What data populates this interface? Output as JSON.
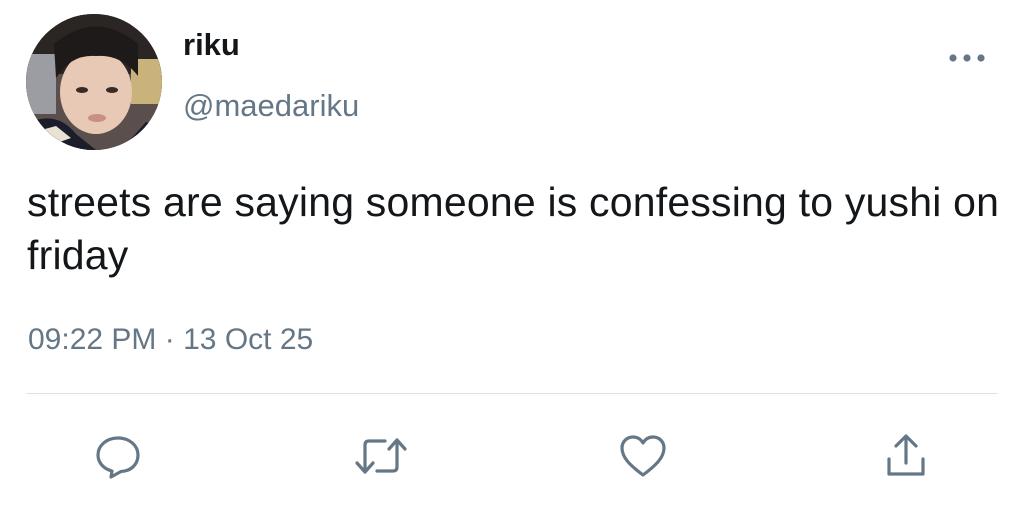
{
  "author": {
    "display_name": "riku",
    "handle": "@maedariku"
  },
  "tweet": {
    "text": "streets are saying someone is confessing to yushi on friday",
    "time": "09:22 PM",
    "separator": "·",
    "date": "13 Oct 25"
  },
  "icons": {
    "more": "more-horizontal-icon",
    "reply": "reply-icon",
    "retweet": "retweet-icon",
    "like": "heart-icon",
    "share": "share-icon"
  },
  "colors": {
    "text_primary": "#14171a",
    "text_secondary": "#657786",
    "icon": "#657786",
    "divider": "#dfe3e8"
  }
}
